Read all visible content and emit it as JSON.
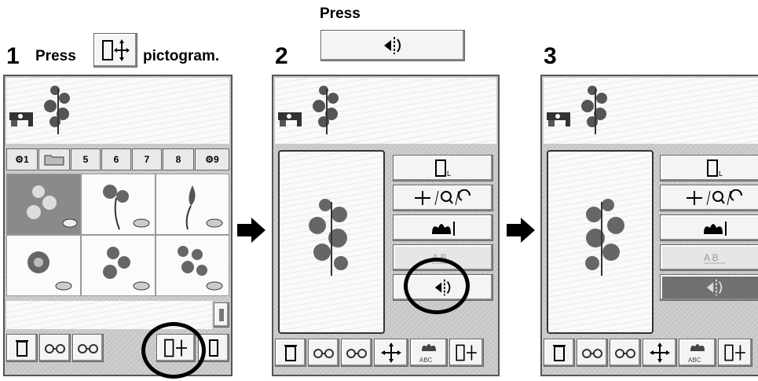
{
  "steps": [
    {
      "number": "1",
      "text_before": "Press",
      "text_after": "pictogram."
    },
    {
      "number": "2",
      "text_above": "Press"
    },
    {
      "number": "3"
    }
  ],
  "panel1": {
    "category_tabs": [
      "1",
      "5",
      "6",
      "7",
      "8",
      "9"
    ]
  },
  "icons": {
    "layout_pictogram": "layout-pictogram-icon",
    "mirror_pictogram": "mirror-image-icon"
  }
}
